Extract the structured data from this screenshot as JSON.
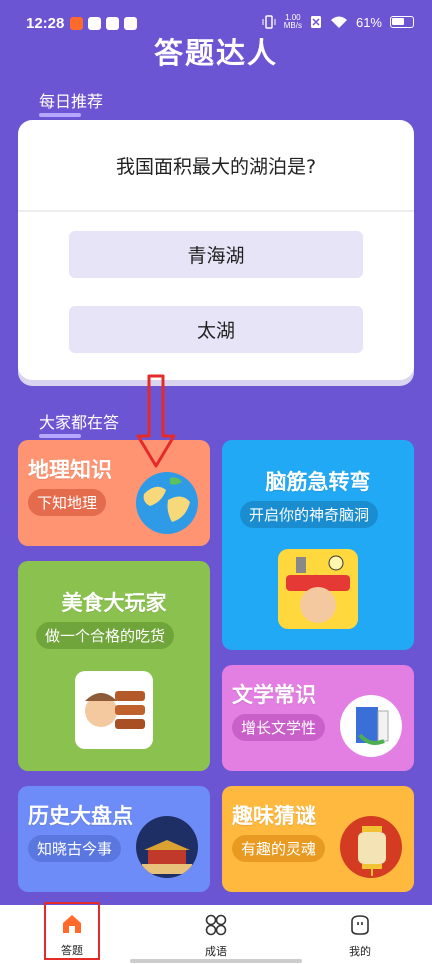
{
  "status_bar": {
    "time": "12:28",
    "speed_top": "1.00",
    "speed_bottom": "MB/s",
    "battery": "61%"
  },
  "app": {
    "title": "答题达人"
  },
  "daily": {
    "section_label": "每日推荐",
    "question": "我国面积最大的湖泊是?",
    "options": [
      "青海湖",
      "太湖"
    ]
  },
  "popular": {
    "section_label": "大家都在答",
    "cards": [
      {
        "title": "地理知识",
        "subtitle": "下知地理",
        "color": "#ff9472"
      },
      {
        "title": "脑筋急转弯",
        "subtitle": "开启你的神奇脑洞",
        "color": "#22a9f5"
      },
      {
        "title": "美食大玩家",
        "subtitle": "做一个合格的吃货",
        "color": "#8bc24f"
      },
      {
        "title": "文学常识",
        "subtitle": "增长文学性",
        "color": "#e37ee3"
      },
      {
        "title": "历史大盘点",
        "subtitle": "知晓古今事",
        "color": "#6e8cf7"
      },
      {
        "title": "趣味猜谜",
        "subtitle": "有趣的灵魂",
        "color": "#ffb93e"
      }
    ]
  },
  "tabs": [
    {
      "label": "答题",
      "icon": "home-icon",
      "active": true
    },
    {
      "label": "成语",
      "icon": "grid-icon",
      "active": false
    },
    {
      "label": "我的",
      "icon": "profile-icon",
      "active": false
    }
  ],
  "colors": {
    "background": "#6c55d3",
    "active_tab": "#ff6a2b",
    "highlight_box": "#e52a2a",
    "arrow": "#e52a2a"
  }
}
